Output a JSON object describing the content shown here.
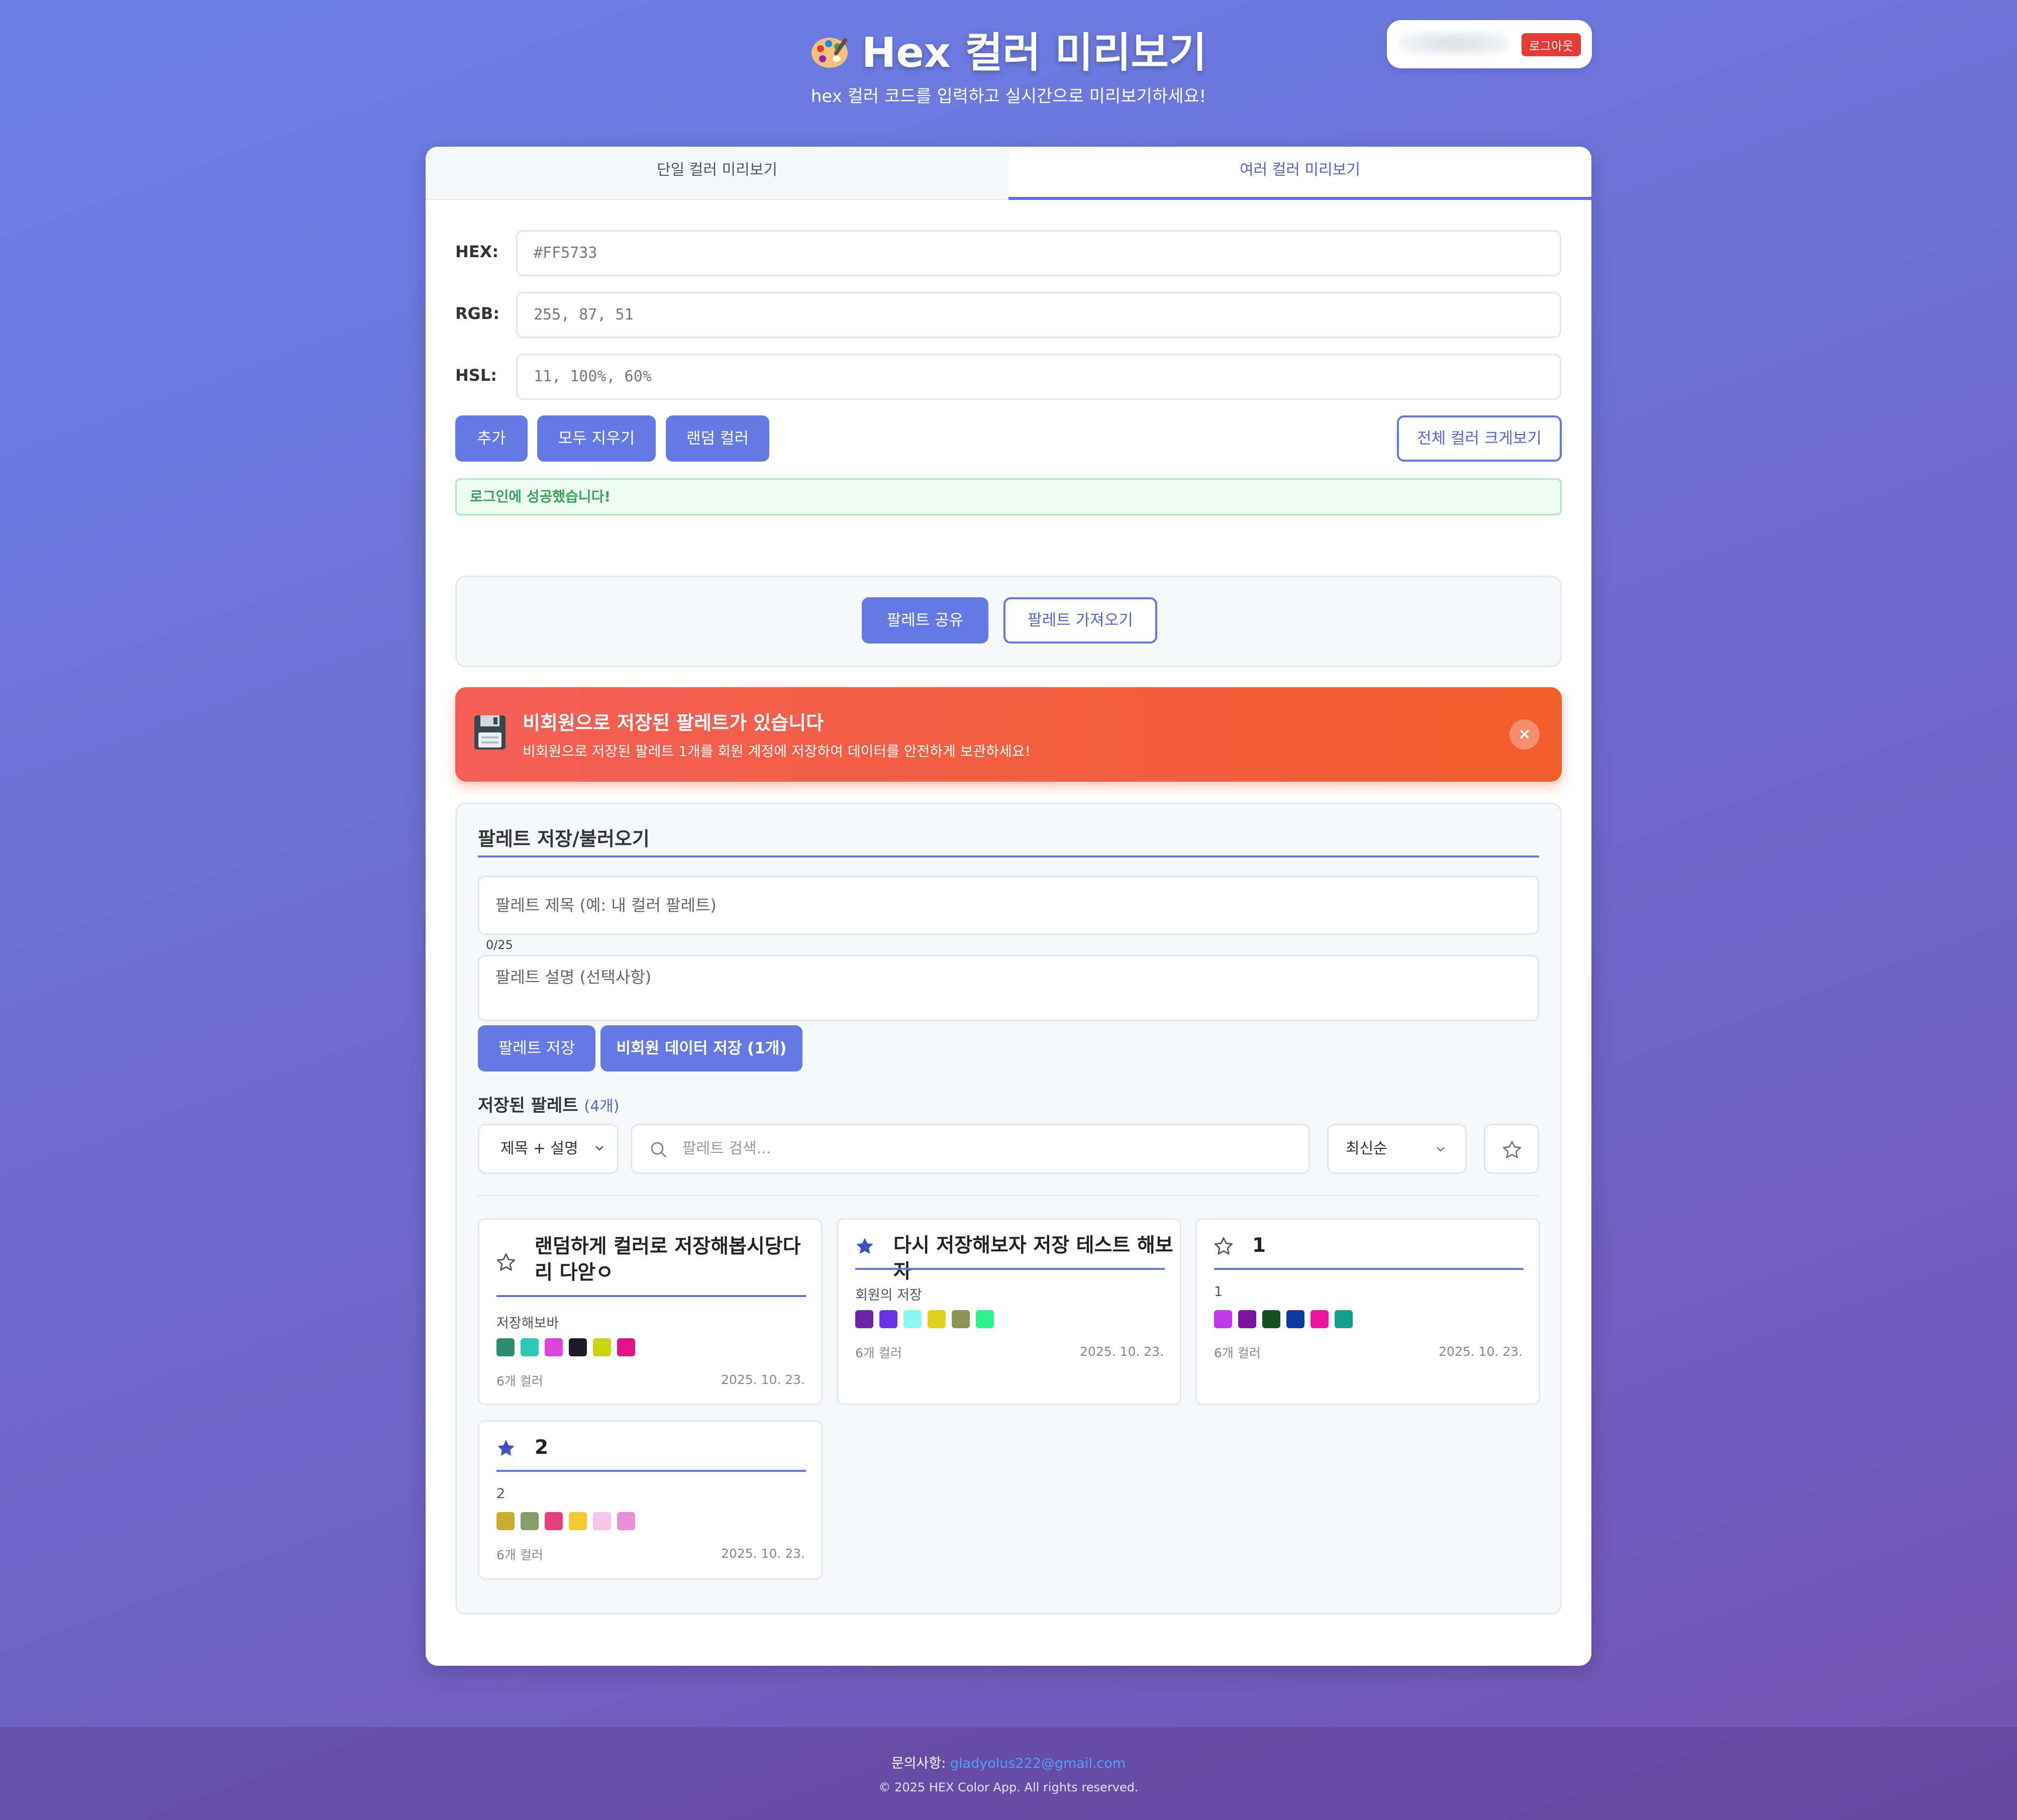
{
  "header": {
    "title": "Hex 컬러 미리보기",
    "subtitle": "hex 컬러 코드를 입력하고 실시간으로 미리보기하세요!",
    "logout_label": "로그아웃"
  },
  "tabs": [
    {
      "label": "단일 컬러 미리보기",
      "active": false
    },
    {
      "label": "여러 컬러 미리보기",
      "active": true
    }
  ],
  "inputs": {
    "hex": {
      "label": "HEX:",
      "placeholder": "#FF5733"
    },
    "rgb": {
      "label": "RGB:",
      "placeholder": "255, 87, 51"
    },
    "hsl": {
      "label": "HSL:",
      "placeholder": "11, 100%, 60%"
    }
  },
  "actions": {
    "add": "추가",
    "clear_all": "모두 지우기",
    "random": "랜덤 컬러",
    "view_all": "전체 컬러 크게보기"
  },
  "alert": "로그인에 성공했습니다!",
  "share": {
    "share_label": "팔레트 공유",
    "import_label": "팔레트 가져오기"
  },
  "guest_banner": {
    "title": "비회원으로 저장된 팔레트가 있습니다",
    "text": "비회원으로 저장된 팔레트 1개를 회원 계정에 저장하여 데이터를 안전하게 보관하세요!",
    "close": "×"
  },
  "save_section": {
    "title": "팔레트 저장/불러오기",
    "title_placeholder": "팔레트 제목 (예: 내 컬러 팔레트)",
    "counter": "0/25",
    "desc_placeholder": "팔레트 설명 (선택사항)",
    "save_label": "팔레트 저장",
    "guest_save_label": "비회원 데이터 저장 (1개)",
    "saved_heading": "저장된 팔레트",
    "saved_count": "(4개)",
    "filter_select": "제목 + 설명",
    "search_placeholder": "팔레트 검색...",
    "sort_select": "최신순"
  },
  "palettes": [
    {
      "title": "랜덤하게 컬러로 저장해봅시당다리 다앋ㅇ",
      "favorite": false,
      "description": "저장해보바",
      "colors": [
        "#2e8b74",
        "#2ec9b4",
        "#dd44dd",
        "#1c1c28",
        "#c9d40a",
        "#e0148b"
      ],
      "count": "6개 컬러",
      "date": "2025. 10. 23."
    },
    {
      "title": "다시 저장해보자 저장 테스트 해보자",
      "favorite": true,
      "description": "회원의 저장",
      "colors": [
        "#6b25a8",
        "#6a32e6",
        "#8cf7ef",
        "#dfd21b",
        "#8d9456",
        "#2ef08c"
      ],
      "count": "6개 컬러",
      "date": "2025. 10. 23."
    },
    {
      "title": "1",
      "favorite": false,
      "description": "1",
      "colors": [
        "#c038e8",
        "#7a149e",
        "#12501f",
        "#0f3a9c",
        "#f0139c",
        "#119e8c"
      ],
      "count": "6개 컬러",
      "date": "2025. 10. 23."
    },
    {
      "title": "2",
      "favorite": true,
      "description": "2",
      "colors": [
        "#c9ad2e",
        "#859d6b",
        "#e83e7d",
        "#f2cb2e",
        "#f3c6ea",
        "#e68ed6"
      ],
      "count": "6개 컬러",
      "date": "2025. 10. 23."
    }
  ],
  "footer": {
    "contact_label": "문의사항:",
    "email": "gladyolus222@gmail.com",
    "copyright": "© 2025 HEX Color App. All rights reserved."
  },
  "colors": {
    "primary": "#6479e4",
    "banner": "#f25d2c",
    "favorite_star": "#3f4fc4",
    "success": "#36a35a"
  }
}
